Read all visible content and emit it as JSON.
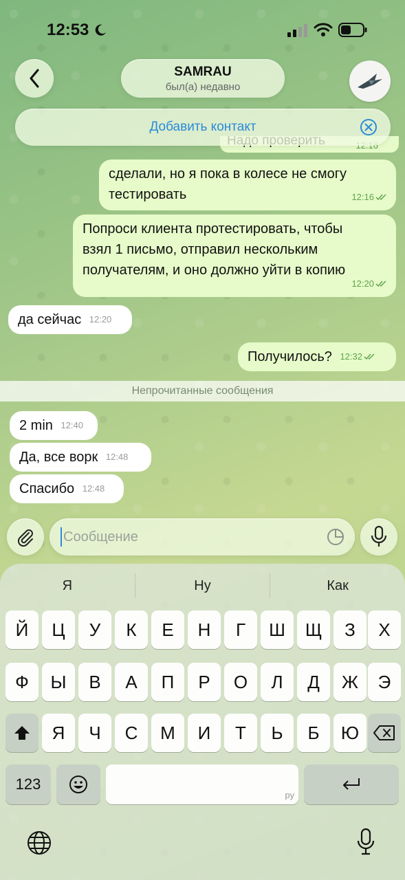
{
  "status": {
    "time": "12:53"
  },
  "header": {
    "contact_name": "SAMRAU",
    "contact_status": "был(а) недавно",
    "add_contact_label": "Добавить контакт"
  },
  "messages": [
    {
      "dir": "out",
      "text_1": "сделали, но я пока в колесе не смогу",
      "text_2": "тестировать",
      "time": "12:16"
    },
    {
      "dir": "out",
      "text_1": "Попроси клиента протестировать, чтобы",
      "text_2": "взял 1 письмо, отправил нескольким",
      "text_3": "получателям, и оно должно уйти в копию",
      "time": "12:20"
    },
    {
      "dir": "in",
      "text": "да сейчас",
      "time": "12:20"
    },
    {
      "dir": "out",
      "text": "Получилось?",
      "time": "12:32"
    },
    {
      "dir": "in",
      "text": "2 min",
      "time": "12:40"
    },
    {
      "dir": "in",
      "text": "Да, все ворк",
      "time": "12:48"
    },
    {
      "dir": "in",
      "text": "Спасибо",
      "time": "12:48"
    }
  ],
  "partial_message": {
    "text": "Надо проверить",
    "time": "12:16"
  },
  "unread_divider": "Непрочитанные сообщения",
  "composer": {
    "placeholder": "Сообщение"
  },
  "keyboard": {
    "suggestions": [
      "Я",
      "Ну",
      "Как"
    ],
    "row1": [
      "Й",
      "Ц",
      "У",
      "К",
      "Е",
      "Н",
      "Г",
      "Ш",
      "Щ",
      "З",
      "Х"
    ],
    "row2": [
      "Ф",
      "Ы",
      "В",
      "А",
      "П",
      "Р",
      "О",
      "Л",
      "Д",
      "Ж",
      "Э"
    ],
    "row3": [
      "Я",
      "Ч",
      "С",
      "М",
      "И",
      "Т",
      "Ь",
      "Б",
      "Ю"
    ],
    "numbers_key": "123",
    "space_lang": "ру"
  }
}
